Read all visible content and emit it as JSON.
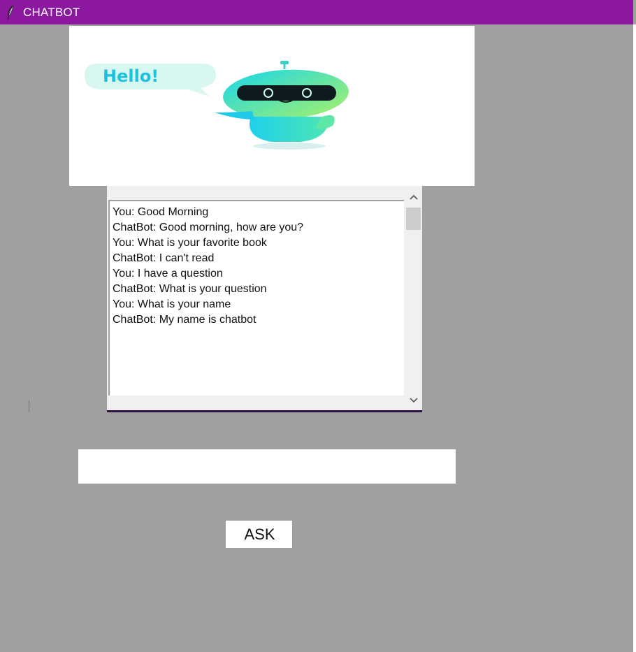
{
  "window": {
    "title": "CHATBOT",
    "titlebar_color": "#8b189e",
    "icon": "feather-icon"
  },
  "banner": {
    "speech_bubble_text": "Hello!",
    "image": "robot-illustration"
  },
  "chat_log": {
    "messages": [
      "You: Good Morning",
      "ChatBot: Good morning, how are you?",
      "You: What is your favorite book",
      "ChatBot: I can't read",
      "You: I have a question",
      "ChatBot: What is your question",
      "You: What is your name",
      "ChatBot: My name is chatbot"
    ]
  },
  "input": {
    "value": ""
  },
  "ask_button": {
    "label": "ASK"
  }
}
